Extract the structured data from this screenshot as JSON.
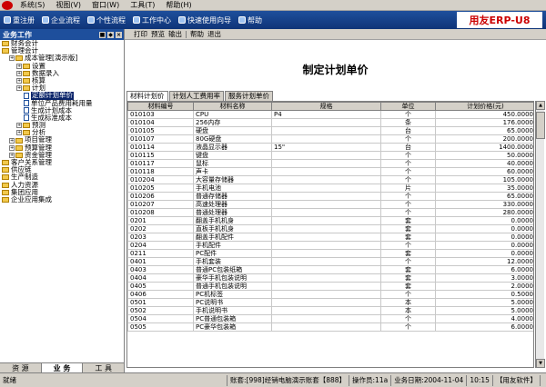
{
  "menubar": {
    "items": [
      "系统(S)",
      "视图(V)",
      "窗口(W)",
      "工具(T)",
      "帮助(H)"
    ]
  },
  "toolbar": {
    "items": [
      "重注册",
      "企业流程",
      "个性流程",
      "工作中心",
      "快速使用向导",
      "帮助"
    ],
    "brand": "用友ERP-U8"
  },
  "sidebar": {
    "title": "业务工作",
    "tree": [
      {
        "label": "财务会计",
        "level": 0,
        "type": "folder"
      },
      {
        "label": "管理会计",
        "level": 0,
        "type": "folder"
      },
      {
        "label": "成本管理[演示版]",
        "level": 1,
        "type": "folder"
      },
      {
        "label": "设置",
        "level": 2,
        "type": "folder"
      },
      {
        "label": "数据录入",
        "level": 2,
        "type": "folder"
      },
      {
        "label": "核算",
        "level": 2,
        "type": "folder"
      },
      {
        "label": "计划",
        "level": 2,
        "type": "folder"
      },
      {
        "label": "定额计划单价",
        "level": 3,
        "type": "doc",
        "selected": true
      },
      {
        "label": "单位产品费用耗用量",
        "level": 3,
        "type": "doc"
      },
      {
        "label": "生成计划成本",
        "level": 3,
        "type": "doc"
      },
      {
        "label": "生成标准成本",
        "level": 3,
        "type": "doc"
      },
      {
        "label": "预测",
        "level": 2,
        "type": "folder"
      },
      {
        "label": "分析",
        "level": 2,
        "type": "folder"
      },
      {
        "label": "项目管理",
        "level": 1,
        "type": "folder"
      },
      {
        "label": "预算管理",
        "level": 1,
        "type": "folder"
      },
      {
        "label": "资金管理",
        "level": 1,
        "type": "folder"
      },
      {
        "label": "客户关系管理",
        "level": 0,
        "type": "folder"
      },
      {
        "label": "供应链",
        "level": 0,
        "type": "folder"
      },
      {
        "label": "生产制造",
        "level": 0,
        "type": "folder"
      },
      {
        "label": "人力资源",
        "level": 0,
        "type": "folder"
      },
      {
        "label": "集团应用",
        "level": 0,
        "type": "folder"
      },
      {
        "label": "企业应用集成",
        "level": 0,
        "type": "folder"
      }
    ],
    "tabs": [
      "资 源",
      "业 务",
      "工 具"
    ]
  },
  "main": {
    "toolbar": [
      "打印",
      "预览",
      "输出",
      "帮助",
      "退出"
    ],
    "title": "制定计划单价",
    "tabs": [
      "材料计划价",
      "计划人工费用率",
      "服务计划单价"
    ],
    "table": {
      "headers": [
        "材料编号",
        "材料名称",
        "规格",
        "单位",
        "计划价格(元)"
      ],
      "rows": [
        [
          "010103",
          "CPU",
          "P4",
          "个",
          "450.0000"
        ],
        [
          "010104",
          "256内存",
          "",
          "条",
          "176.0000"
        ],
        [
          "010105",
          "硬盘",
          "",
          "台",
          "65.0000"
        ],
        [
          "010107",
          "80G硬盘",
          "",
          "个",
          "200.0000"
        ],
        [
          "010114",
          "液晶显示器",
          "15\"",
          "台",
          "1400.0000"
        ],
        [
          "010115",
          "键盘",
          "",
          "个",
          "50.0000"
        ],
        [
          "010117",
          "鼠标",
          "",
          "个",
          "40.0000"
        ],
        [
          "010118",
          "声卡",
          "",
          "个",
          "60.0000"
        ],
        [
          "010204",
          "大容量存储器",
          "",
          "个",
          "105.0000"
        ],
        [
          "010205",
          "手机电池",
          "",
          "片",
          "35.0000"
        ],
        [
          "010206",
          "普通存储器",
          "",
          "个",
          "65.0000"
        ],
        [
          "010207",
          "高速处理器",
          "",
          "个",
          "330.0000"
        ],
        [
          "010208",
          "普通处理器",
          "",
          "个",
          "280.0000"
        ],
        [
          "0201",
          "翻盖手机机身",
          "",
          "套",
          "0.0000"
        ],
        [
          "0202",
          "直板手机机身",
          "",
          "套",
          "0.0000"
        ],
        [
          "0203",
          "翻盖手机配件",
          "",
          "套",
          "0.0000"
        ],
        [
          "0204",
          "手机配件",
          "",
          "个",
          "0.0000"
        ],
        [
          "0211",
          "PC配件",
          "",
          "套",
          "0.0000"
        ],
        [
          "0401",
          "手机套装",
          "",
          "个",
          "12.0000"
        ],
        [
          "0403",
          "普通PC包装纸箱",
          "",
          "套",
          "6.0000"
        ],
        [
          "0404",
          "豪华手机包装说明",
          "",
          "套",
          "3.0000"
        ],
        [
          "0405",
          "普通手机包装说明",
          "",
          "套",
          "2.0000"
        ],
        [
          "0406",
          "PC机标签",
          "",
          "个",
          "0.5000"
        ],
        [
          "0501",
          "PC说明书",
          "",
          "本",
          "5.0000"
        ],
        [
          "0502",
          "手机说明书",
          "",
          "本",
          "5.0000"
        ],
        [
          "0504",
          "PC普通包装箱",
          "",
          "个",
          "4.0000"
        ],
        [
          "0505",
          "PC豪华包装箱",
          "",
          "个",
          "6.0000"
        ]
      ]
    }
  },
  "status": {
    "ready": "就绪",
    "account": "账套:[998]经销电脑演示账套【888】",
    "operator": "操作员:11a",
    "date": "业务日期:2004-11-04",
    "time": "10:15",
    "company": "【用友软件】"
  }
}
